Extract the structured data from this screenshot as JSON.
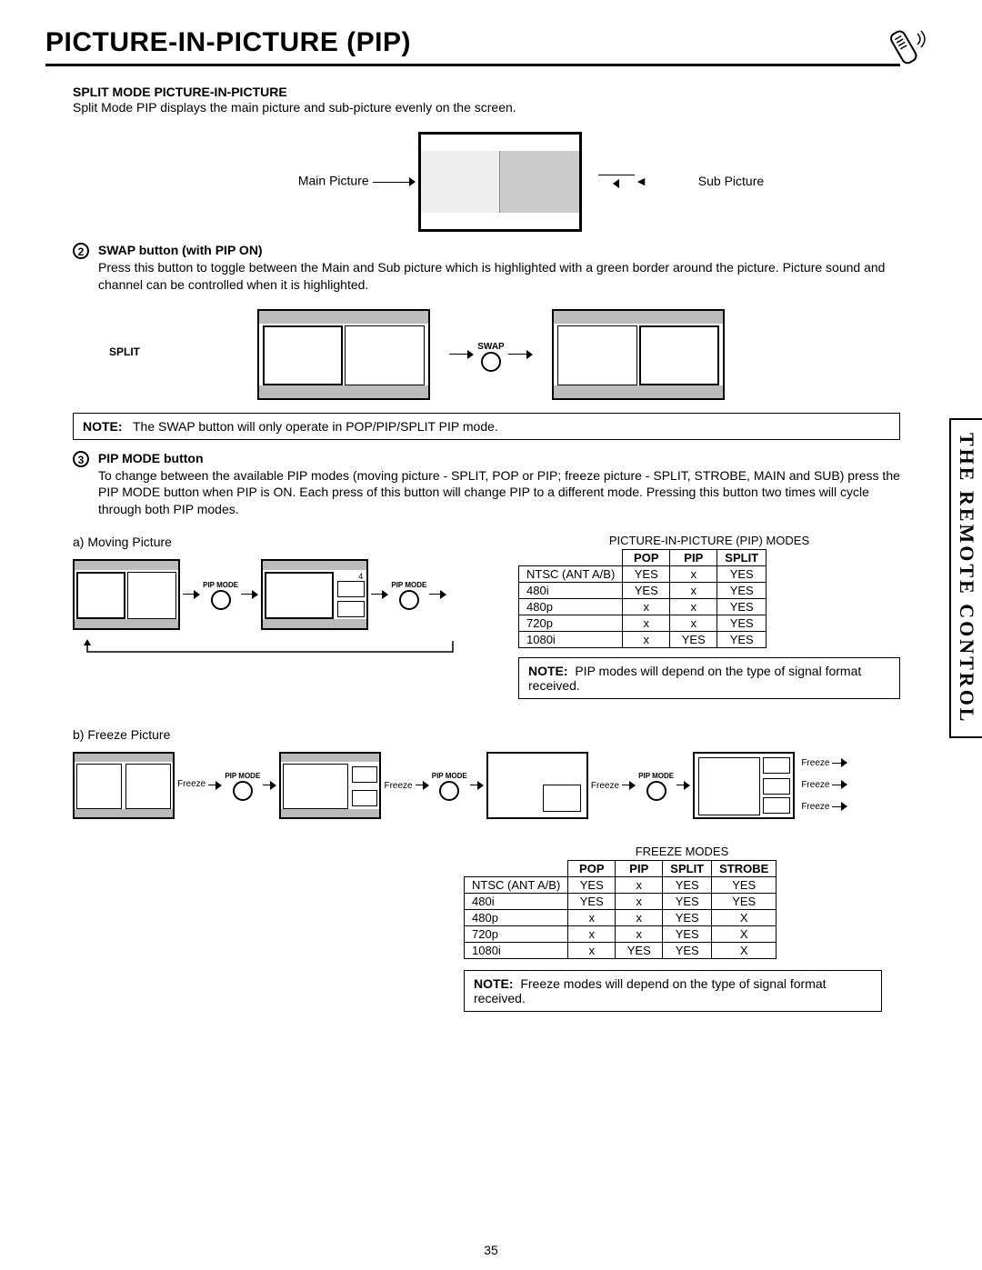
{
  "side_tab": "THE REMOTE CONTROL",
  "title": "PICTURE-IN-PICTURE (PIP)",
  "page_number": "35",
  "split_mode": {
    "heading": "SPLIT MODE PICTURE-IN-PICTURE",
    "body": "Split Mode PIP displays the main picture and sub-picture evenly on the screen.",
    "main_label": "Main Picture",
    "sub_label": "Sub Picture"
  },
  "swap": {
    "num": "2",
    "heading": "SWAP button (with PIP ON)",
    "body": "Press this button to toggle between the Main and Sub picture which is highlighted with a green border around the picture.  Picture sound and channel can be controlled when it is highlighted.",
    "split_label": "SPLIT",
    "swap_label": "SWAP",
    "note_label": "NOTE:",
    "note_text": "The SWAP button will only operate in POP/PIP/SPLIT PIP mode."
  },
  "pipmode": {
    "num": "3",
    "heading": "PIP MODE button",
    "body": "To change between the available PIP modes (moving picture - SPLIT, POP or PIP; freeze picture - SPLIT, STROBE, MAIN and SUB) press the PIP MODE button when PIP is ON.  Each press of this button will change PIP to a different mode.  Pressing this button two times will cycle through both PIP modes.",
    "a_label": "a) Moving Picture",
    "b_label": "b) Freeze Picture",
    "pipmode_btn": "PIP MODE",
    "num4": "4",
    "freeze_word": "Freeze"
  },
  "pip_table": {
    "title": "PICTURE-IN-PICTURE (PIP) MODES",
    "cols": [
      "POP",
      "PIP",
      "SPLIT"
    ],
    "rows": [
      {
        "h": "NTSC (ANT A/B)",
        "v": [
          "YES",
          "x",
          "YES"
        ]
      },
      {
        "h": "480i",
        "v": [
          "YES",
          "x",
          "YES"
        ]
      },
      {
        "h": "480p",
        "v": [
          "x",
          "x",
          "YES"
        ]
      },
      {
        "h": "720p",
        "v": [
          "x",
          "x",
          "YES"
        ]
      },
      {
        "h": "1080i",
        "v": [
          "x",
          "YES",
          "YES"
        ]
      }
    ],
    "note_label": "NOTE:",
    "note_text": "PIP modes will depend on the type of signal format received."
  },
  "freeze_table": {
    "title": "FREEZE MODES",
    "cols": [
      "POP",
      "PIP",
      "SPLIT",
      "STROBE"
    ],
    "rows": [
      {
        "h": "NTSC (ANT A/B)",
        "v": [
          "YES",
          "x",
          "YES",
          "YES"
        ]
      },
      {
        "h": "480i",
        "v": [
          "YES",
          "x",
          "YES",
          "YES"
        ]
      },
      {
        "h": "480p",
        "v": [
          "x",
          "x",
          "YES",
          "X"
        ]
      },
      {
        "h": "720p",
        "v": [
          "x",
          "x",
          "YES",
          "X"
        ]
      },
      {
        "h": "1080i",
        "v": [
          "x",
          "YES",
          "YES",
          "X"
        ]
      }
    ],
    "note_label": "NOTE:",
    "note_text": "Freeze modes will depend on the type of signal format received."
  }
}
